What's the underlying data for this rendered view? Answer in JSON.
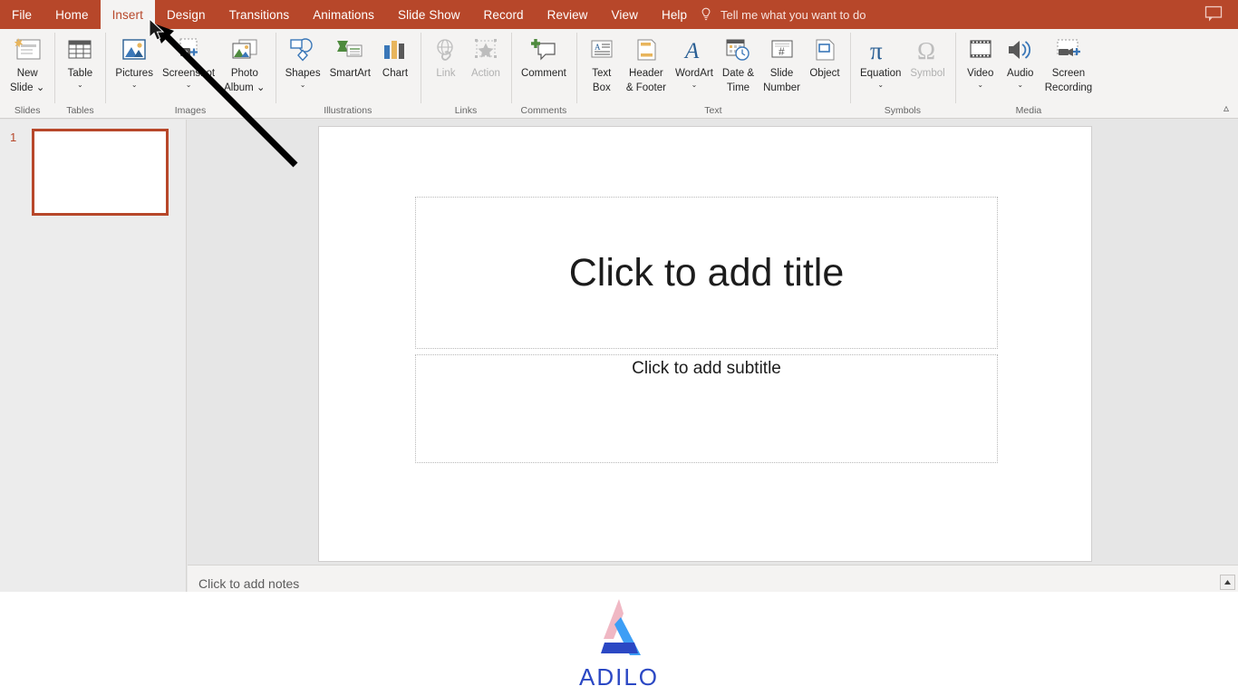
{
  "app": {
    "accent": "#b7472a",
    "ribbon_bg": "#f4f3f2",
    "workspace_bg": "#e6e6e6"
  },
  "tabs": [
    {
      "label": "File",
      "active": false
    },
    {
      "label": "Home",
      "active": false
    },
    {
      "label": "Insert",
      "active": true
    },
    {
      "label": "Design",
      "active": false
    },
    {
      "label": "Transitions",
      "active": false
    },
    {
      "label": "Animations",
      "active": false
    },
    {
      "label": "Slide Show",
      "active": false
    },
    {
      "label": "Record",
      "active": false
    },
    {
      "label": "Review",
      "active": false
    },
    {
      "label": "View",
      "active": false
    },
    {
      "label": "Help",
      "active": false
    }
  ],
  "tellme": {
    "label": "Tell me what you want to do",
    "icon": "lightbulb-icon"
  },
  "top_right": {
    "icon": "comments-callout-icon"
  },
  "ribbon": {
    "collapse_icon": "chevron-up-icon",
    "groups": [
      {
        "label": "Slides",
        "buttons": [
          {
            "name": "new-slide",
            "label_line1": "New",
            "label_line2": "Slide",
            "icon": "new-slide-icon",
            "dropdown": "inline",
            "disabled": false
          }
        ]
      },
      {
        "label": "Tables",
        "buttons": [
          {
            "name": "table",
            "label_line1": "Table",
            "label_line2": "",
            "icon": "table-icon",
            "dropdown": "below",
            "disabled": false
          }
        ]
      },
      {
        "label": "Images",
        "buttons": [
          {
            "name": "pictures",
            "label_line1": "Pictures",
            "label_line2": "",
            "icon": "pictures-icon",
            "dropdown": "below",
            "disabled": false
          },
          {
            "name": "screenshot",
            "label_line1": "Screenshot",
            "label_line2": "",
            "icon": "screenshot-icon",
            "dropdown": "below",
            "disabled": false
          },
          {
            "name": "photo-album",
            "label_line1": "Photo",
            "label_line2": "Album",
            "icon": "photo-album-icon",
            "dropdown": "inline",
            "disabled": false
          }
        ]
      },
      {
        "label": "Illustrations",
        "buttons": [
          {
            "name": "shapes",
            "label_line1": "Shapes",
            "label_line2": "",
            "icon": "shapes-icon",
            "dropdown": "below",
            "disabled": false
          },
          {
            "name": "smartart",
            "label_line1": "SmartArt",
            "label_line2": "",
            "icon": "smartart-icon",
            "dropdown": "none",
            "disabled": false
          },
          {
            "name": "chart",
            "label_line1": "Chart",
            "label_line2": "",
            "icon": "chart-icon",
            "dropdown": "none",
            "disabled": false
          }
        ]
      },
      {
        "label": "Links",
        "buttons": [
          {
            "name": "link",
            "label_line1": "Link",
            "label_line2": "",
            "icon": "link-icon",
            "dropdown": "none",
            "disabled": true
          },
          {
            "name": "action",
            "label_line1": "Action",
            "label_line2": "",
            "icon": "action-star-icon",
            "dropdown": "none",
            "disabled": true
          }
        ]
      },
      {
        "label": "Comments",
        "buttons": [
          {
            "name": "comment",
            "label_line1": "Comment",
            "label_line2": "",
            "icon": "comment-icon",
            "dropdown": "none",
            "disabled": false
          }
        ]
      },
      {
        "label": "Text",
        "buttons": [
          {
            "name": "text-box",
            "label_line1": "Text",
            "label_line2": "Box",
            "icon": "text-box-icon",
            "dropdown": "none",
            "disabled": false
          },
          {
            "name": "header-footer",
            "label_line1": "Header",
            "label_line2": "& Footer",
            "icon": "header-footer-icon",
            "dropdown": "none",
            "disabled": false
          },
          {
            "name": "wordart",
            "label_line1": "WordArt",
            "label_line2": "",
            "icon": "wordart-icon",
            "dropdown": "below",
            "disabled": false
          },
          {
            "name": "date-time",
            "label_line1": "Date &",
            "label_line2": "Time",
            "icon": "date-time-icon",
            "dropdown": "none",
            "disabled": false
          },
          {
            "name": "slide-number",
            "label_line1": "Slide",
            "label_line2": "Number",
            "icon": "slide-number-icon",
            "dropdown": "none",
            "disabled": false
          },
          {
            "name": "object",
            "label_line1": "Object",
            "label_line2": "",
            "icon": "object-icon",
            "dropdown": "none",
            "disabled": false
          }
        ]
      },
      {
        "label": "Symbols",
        "buttons": [
          {
            "name": "equation",
            "label_line1": "Equation",
            "label_line2": "",
            "icon": "equation-pi-icon",
            "dropdown": "below",
            "disabled": false
          },
          {
            "name": "symbol",
            "label_line1": "Symbol",
            "label_line2": "",
            "icon": "symbol-omega-icon",
            "dropdown": "none",
            "disabled": true
          }
        ]
      },
      {
        "label": "Media",
        "buttons": [
          {
            "name": "video",
            "label_line1": "Video",
            "label_line2": "",
            "icon": "video-icon",
            "dropdown": "below",
            "disabled": false
          },
          {
            "name": "audio",
            "label_line1": "Audio",
            "label_line2": "",
            "icon": "audio-speaker-icon",
            "dropdown": "below",
            "disabled": false
          },
          {
            "name": "screen-recording",
            "label_line1": "Screen",
            "label_line2": "Recording",
            "icon": "screen-recording-icon",
            "dropdown": "none",
            "disabled": false
          }
        ]
      }
    ]
  },
  "thumbnails": [
    {
      "number": "1",
      "selected": true
    }
  ],
  "slide": {
    "title_placeholder": "Click to add title",
    "subtitle_placeholder": "Click to add subtitle"
  },
  "notes": {
    "placeholder": "Click to add notes",
    "scroll_icon": "scroll-up-arrow-icon"
  },
  "annotation": {
    "arrow": "pointer-arrow-to-insert-tab",
    "cursor": "mouse-cursor-icon"
  },
  "logo": {
    "text": "ADILO",
    "color_text": "#2b48c4",
    "color_left": "#f0b8c4",
    "color_right": "#3d9ef5",
    "color_base": "#2b48c4"
  }
}
